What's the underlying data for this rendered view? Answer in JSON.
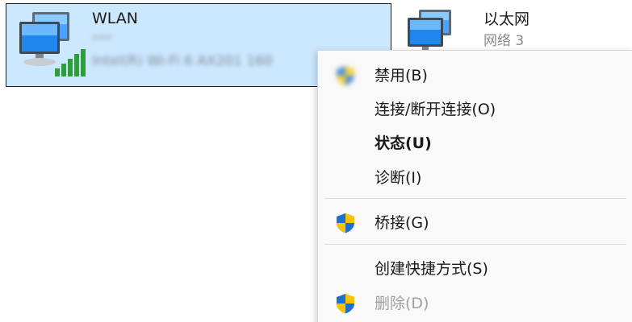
{
  "adapters": {
    "wlan": {
      "name": "WLAN",
      "sub": "***",
      "detail": "Intel(R) Wi-Fi 6 AX201 160"
    },
    "ethernet": {
      "name": "以太网",
      "sub": "网络 3"
    }
  },
  "menu": {
    "items": [
      {
        "label": "禁用(B)",
        "icon": "shield-icon"
      },
      {
        "label": "连接/断开连接(O)"
      },
      {
        "label": "状态(U)",
        "bold": true
      },
      {
        "label": "诊断(I)"
      },
      {
        "label": "桥接(G)",
        "icon": "shield-icon"
      },
      {
        "label": "创建快捷方式(S)"
      },
      {
        "label": "删除(D)",
        "icon": "shield-icon",
        "disabled": true
      }
    ]
  },
  "colors": {
    "selection_bg": "#cce8ff",
    "menu_bg": "#f9f9f9",
    "signal_green": "#2e9e3a",
    "shield_blue": "#1e6fd0",
    "shield_yellow": "#f6c500"
  }
}
